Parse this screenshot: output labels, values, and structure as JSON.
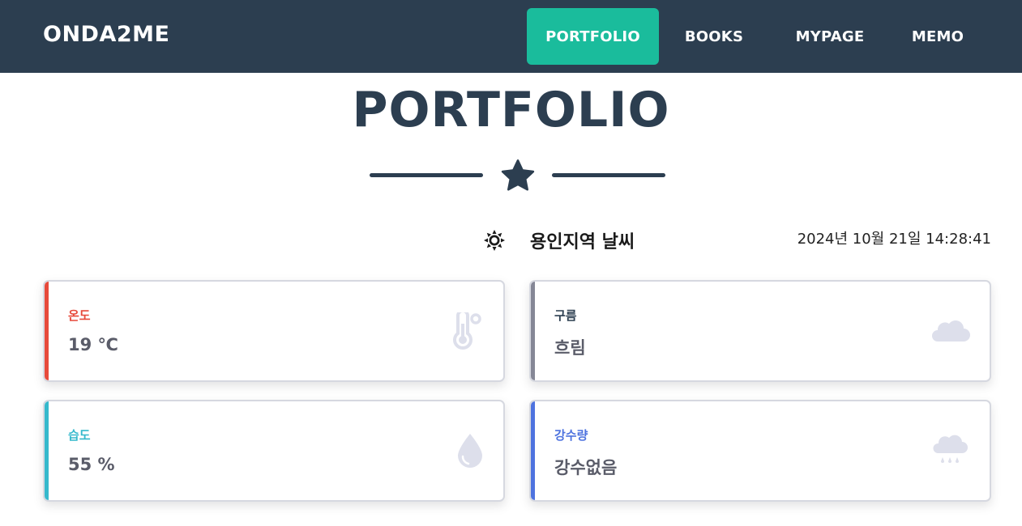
{
  "navbar": {
    "brand": "ONDA2ME",
    "items": [
      {
        "label": "PORTFOLIO",
        "active": true
      },
      {
        "label": "BOOKS",
        "active": false
      },
      {
        "label": "MYPAGE",
        "active": false
      },
      {
        "label": "MEMO",
        "active": false
      }
    ]
  },
  "page": {
    "heading": "PORTFOLIO",
    "divider_icon": "star-icon"
  },
  "weather": {
    "icon": "sun-icon",
    "title": "용인지역 날씨",
    "datetime": "2024년 10월 21일 14:28:41",
    "cards": [
      {
        "label": "온도",
        "value": "19 ℃",
        "icon": "thermometer-icon",
        "accent": "#e74a3b",
        "label_color": "#e74a3b"
      },
      {
        "label": "구름",
        "value": "흐림",
        "icon": "cloud-icon",
        "accent": "#858796",
        "label_color": "#2c3e50"
      },
      {
        "label": "습도",
        "value": "55 %",
        "icon": "droplet-icon",
        "accent": "#36b9cc",
        "label_color": "#36b9cc"
      },
      {
        "label": "강수량",
        "value": "강수없음",
        "icon": "cloud-rain-icon",
        "accent": "#4e73df",
        "label_color": "#4e73df"
      }
    ]
  },
  "colors": {
    "navbar_bg": "#2c3e50",
    "active_nav_bg": "#1abc9c",
    "icon_gray": "#dddfeb"
  }
}
